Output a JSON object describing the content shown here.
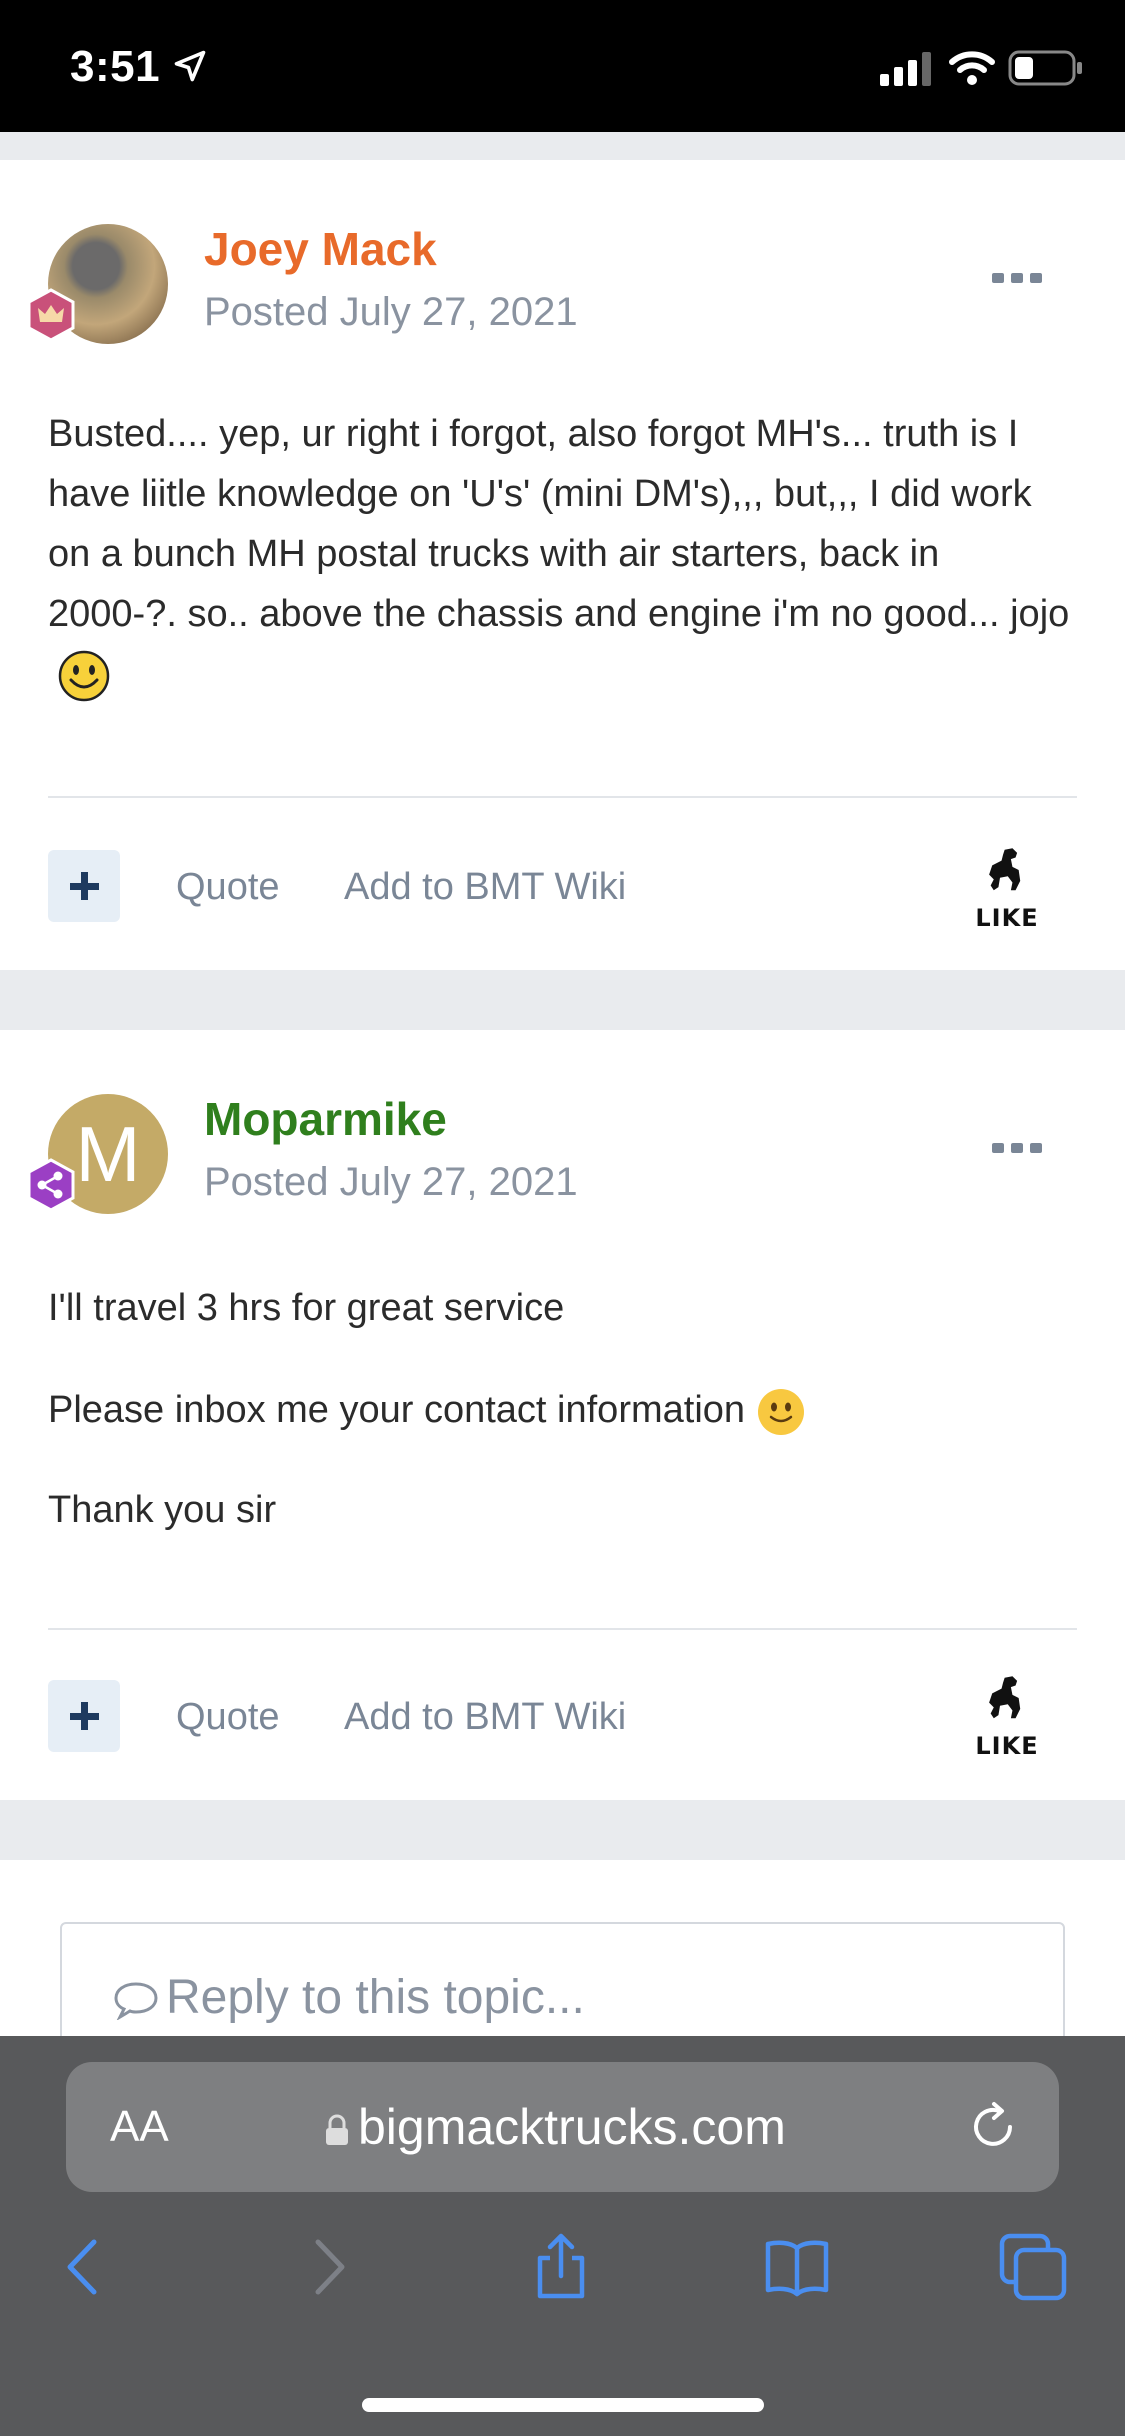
{
  "status_bar": {
    "time": "3:51"
  },
  "posts": [
    {
      "author": "Joey Mack",
      "author_color": "#e86a2a",
      "posted": "Posted July 27, 2021",
      "body": "Busted.... yep, ur right i forgot, also forgot MH's...  truth is I have liitle knowledge on 'U's' (mini DM's),,, but,,, I did work on a bunch MH postal trucks with air starters, back in 2000-?. so.. above the chassis and engine i'm no good...  jojo",
      "actions": {
        "quote": "Quote",
        "wiki": "Add to BMT Wiki",
        "like": "LIKE"
      }
    },
    {
      "author": "Moparmike",
      "author_color": "#2f7f1d",
      "avatar_letter": "M",
      "posted": "Posted July 27, 2021",
      "paragraphs": [
        "I'll travel 3 hrs for great service",
        "Please inbox me your contact information",
        "Thank you sir"
      ],
      "actions": {
        "quote": "Quote",
        "wiki": "Add to BMT Wiki",
        "like": "LIKE"
      }
    }
  ],
  "reply": {
    "placeholder": "Reply to this topic..."
  },
  "browser": {
    "aa_label": "AA",
    "url": "bigmacktrucks.com"
  },
  "icons": [
    "location-arrow-icon",
    "signal-icon",
    "wifi-icon",
    "battery-icon",
    "crown-badge-icon",
    "share-badge-icon",
    "more-icon",
    "plus-icon",
    "bulldog-icon",
    "smiley-icon",
    "comment-icon",
    "lock-icon",
    "reload-icon",
    "back-icon",
    "forward-icon",
    "share-icon",
    "bookmarks-icon",
    "tabs-icon"
  ]
}
